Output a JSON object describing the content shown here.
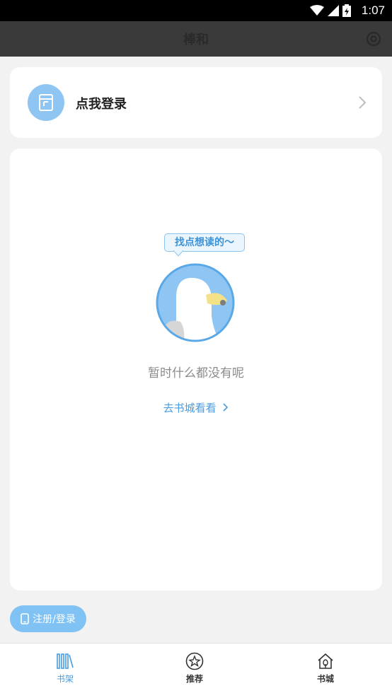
{
  "status_bar": {
    "time": "1:07"
  },
  "app_header": {
    "title": "棒和",
    "settings_icon": "settings-icon"
  },
  "login_card": {
    "label": "点我登录",
    "avatar_icon": "book-icon"
  },
  "empty_state": {
    "bubble": "找点想读的～",
    "message": "暂时什么都没有呢",
    "link": "去书城看看",
    "mascot_icon": "bird-mascot-icon"
  },
  "register_button": {
    "label": "注册/登录"
  },
  "tabs": [
    {
      "label": "书架",
      "icon": "bookshelf-icon",
      "active": true
    },
    {
      "label": "推荐",
      "icon": "star-icon",
      "active": false
    },
    {
      "label": "书城",
      "icon": "store-house-icon",
      "active": false
    }
  ],
  "colors": {
    "accent": "#4a9be0",
    "button": "#80c2f4",
    "header": "#3a3a3a",
    "background": "#f2f2f2"
  }
}
